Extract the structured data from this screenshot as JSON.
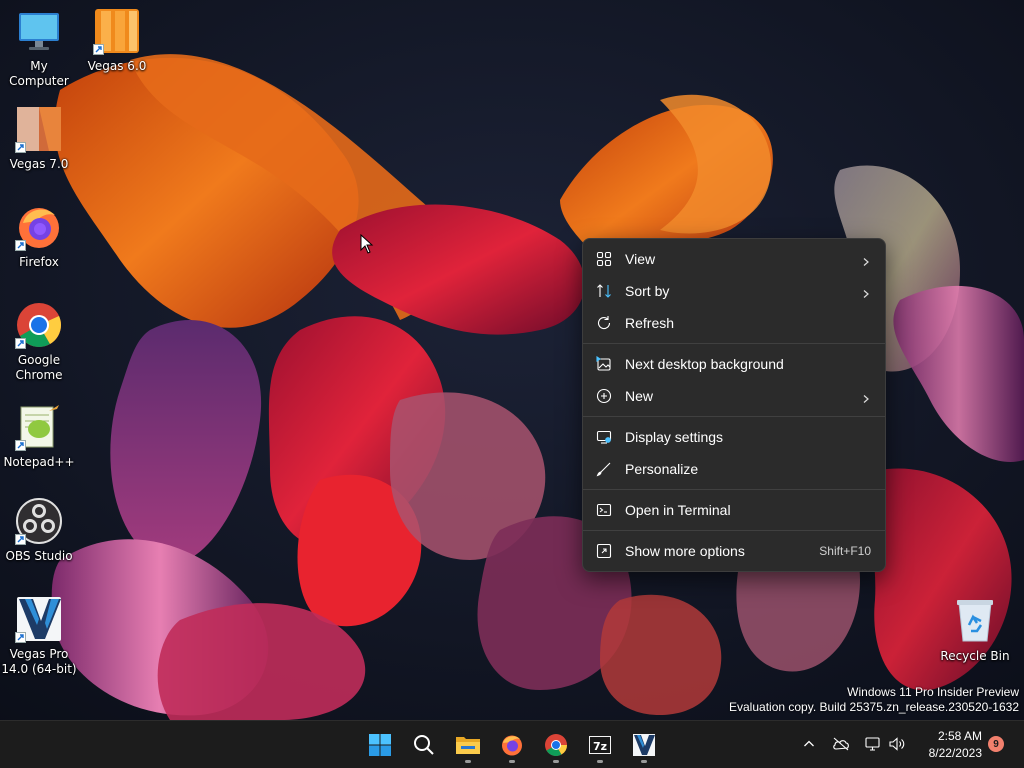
{
  "desktop_icons": [
    {
      "label": "My Computer",
      "icon": "monitor-icon"
    },
    {
      "label": "Vegas 6.0",
      "icon": "vegas-6-icon"
    },
    {
      "label": "Vegas 7.0",
      "icon": "vegas-7-icon"
    },
    {
      "label": "Firefox",
      "icon": "firefox-icon"
    },
    {
      "label": "Google\nChrome",
      "icon": "chrome-icon"
    },
    {
      "label": "Notepad++",
      "icon": "notepadpp-icon"
    },
    {
      "label": "OBS Studio",
      "icon": "obs-icon"
    },
    {
      "label": "Vegas Pro\n14.0 (64-bit)",
      "icon": "vegas-pro-icon"
    },
    {
      "label": "Recycle Bin",
      "icon": "recycle-bin-icon"
    }
  ],
  "context_menu": {
    "items": [
      {
        "label": "View",
        "icon": "grid-view-icon",
        "submenu": true
      },
      {
        "label": "Sort by",
        "icon": "sort-icon",
        "submenu": true
      },
      {
        "label": "Refresh",
        "icon": "refresh-icon",
        "submenu": false
      },
      {
        "label": "Next desktop background",
        "icon": "next-background-icon",
        "submenu": false
      },
      {
        "label": "New",
        "icon": "new-plus-icon",
        "submenu": true
      },
      {
        "label": "Display settings",
        "icon": "display-settings-icon",
        "submenu": false
      },
      {
        "label": "Personalize",
        "icon": "personalize-brush-icon",
        "submenu": false
      },
      {
        "label": "Open in Terminal",
        "icon": "terminal-icon",
        "submenu": false
      },
      {
        "label": "Show more options",
        "icon": "more-options-icon",
        "submenu": false,
        "shortcut": "Shift+F10"
      }
    ]
  },
  "watermark": {
    "line1": "Windows 11 Pro Insider Preview",
    "line2": "Evaluation copy. Build 25375.zn_release.230520-1632"
  },
  "taskbar": {
    "apps": [
      "start-icon",
      "search-icon",
      "file-explorer-icon",
      "firefox-icon",
      "chrome-icon",
      "7zip-icon",
      "vegas-pro-icon"
    ],
    "tray": [
      "chevron-up-icon",
      "onedrive-offline-icon",
      "network-icon",
      "volume-icon"
    ],
    "time": "2:58 AM",
    "date": "8/22/2023",
    "notification_count": "9"
  },
  "colors": {
    "menu_bg": "#2b2b2b",
    "taskbar_bg": "#1c1c1c",
    "accent_blue": "#4cc2ff",
    "notification_badge": "#f2806d"
  }
}
